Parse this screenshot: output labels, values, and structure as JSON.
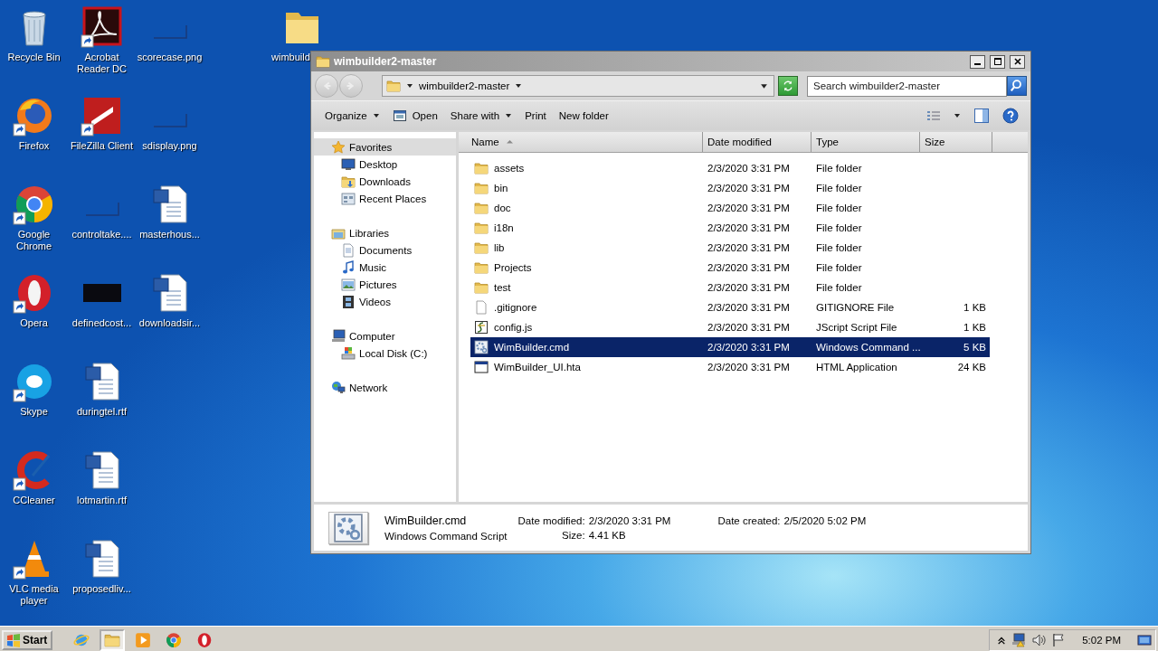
{
  "desktop": {
    "columns": [
      {
        "icons": [
          {
            "label": "Recycle Bin",
            "kind": "recycle",
            "shortcut": false
          },
          {
            "label": "Firefox",
            "kind": "firefox",
            "shortcut": true
          },
          {
            "label": "Google Chrome",
            "kind": "chrome",
            "shortcut": true
          },
          {
            "label": "Opera",
            "kind": "opera",
            "shortcut": true
          },
          {
            "label": "Skype",
            "kind": "skype",
            "shortcut": true
          },
          {
            "label": "CCleaner",
            "kind": "ccleaner",
            "shortcut": true
          },
          {
            "label": "VLC media player",
            "kind": "vlc",
            "shortcut": true
          }
        ]
      },
      {
        "icons": [
          {
            "label": "Acrobat Reader DC",
            "kind": "acrobat",
            "shortcut": true
          },
          {
            "label": "FileZilla Client",
            "kind": "filezilla",
            "shortcut": true
          },
          {
            "label": "controltake....",
            "kind": "image",
            "shortcut": false
          },
          {
            "label": "definedcost...",
            "kind": "dark",
            "shortcut": false
          },
          {
            "label": "duringtel.rtf",
            "kind": "word",
            "shortcut": false
          },
          {
            "label": "lotmartin.rtf",
            "kind": "word",
            "shortcut": false
          },
          {
            "label": "proposedliv...",
            "kind": "word",
            "shortcut": false
          }
        ]
      },
      {
        "icons": [
          {
            "label": "scorecase.png",
            "kind": "image",
            "shortcut": false
          },
          {
            "label": "sdisplay.png",
            "kind": "image",
            "shortcut": false
          },
          {
            "label": "masterhous...",
            "kind": "word",
            "shortcut": false
          },
          {
            "label": "downloadsir...",
            "kind": "word",
            "shortcut": false
          }
        ]
      }
    ],
    "partial_icon": {
      "label": "wimbuild",
      "kind": "folder"
    }
  },
  "window": {
    "title": "wimbuilder2-master",
    "navigation": {
      "back": {
        "disabled": true
      },
      "forward": {
        "disabled": true
      }
    },
    "address": {
      "segments": [
        "wimbuilder2-master"
      ]
    },
    "search": {
      "placeholder": "Search wimbuilder2-master"
    },
    "toolbar": [
      {
        "label": "Organize",
        "kind": "menu"
      },
      {
        "label": "Open",
        "kind": "open"
      },
      {
        "label": "Share with",
        "kind": "menu"
      },
      {
        "label": "Print",
        "kind": "plain"
      },
      {
        "label": "New folder",
        "kind": "plain"
      }
    ],
    "navigation_pane": [
      {
        "label": "Favorites",
        "selected": true,
        "children": [
          {
            "label": "Desktop",
            "selected": false
          },
          {
            "label": "Downloads",
            "selected": false
          },
          {
            "label": "Recent Places",
            "selected": false
          }
        ]
      },
      {
        "label": "Libraries",
        "selected": false,
        "children": [
          {
            "label": "Documents",
            "selected": false
          },
          {
            "label": "Music",
            "selected": false
          },
          {
            "label": "Pictures",
            "selected": false
          },
          {
            "label": "Videos",
            "selected": false
          }
        ]
      },
      {
        "label": "Computer",
        "selected": false,
        "children": [
          {
            "label": "Local Disk (C:)",
            "selected": false
          }
        ]
      },
      {
        "label": "Network",
        "selected": false
      }
    ],
    "table": {
      "columns": [
        {
          "label": "Name",
          "sorted": true
        },
        {
          "label": "Date modified",
          "sorted": false
        },
        {
          "label": "Type",
          "sorted": false
        },
        {
          "label": "Size",
          "sorted": false
        }
      ],
      "rows": [
        {
          "name": "assets",
          "date": "2/3/2020 3:31 PM",
          "type": "File folder",
          "kind": "folder",
          "selected": false
        },
        {
          "name": "bin",
          "date": "2/3/2020 3:31 PM",
          "type": "File folder",
          "kind": "folder",
          "selected": false
        },
        {
          "name": "doc",
          "date": "2/3/2020 3:31 PM",
          "type": "File folder",
          "kind": "folder",
          "selected": false
        },
        {
          "name": "i18n",
          "date": "2/3/2020 3:31 PM",
          "type": "File folder",
          "kind": "folder",
          "selected": false
        },
        {
          "name": "lib",
          "date": "2/3/2020 3:31 PM",
          "type": "File folder",
          "kind": "folder",
          "selected": false
        },
        {
          "name": "Projects",
          "date": "2/3/2020 3:31 PM",
          "type": "File folder",
          "kind": "folder",
          "selected": false
        },
        {
          "name": "test",
          "date": "2/3/2020 3:31 PM",
          "type": "File folder",
          "kind": "folder",
          "selected": false
        },
        {
          "name": ".gitignore",
          "date": "2/3/2020 3:31 PM",
          "type": "GITIGNORE File",
          "size": "1 KB",
          "kind": "blank",
          "selected": false
        },
        {
          "name": "config.js",
          "date": "2/3/2020 3:31 PM",
          "type": "JScript Script File",
          "size": "1 KB",
          "kind": "jscript",
          "selected": false
        },
        {
          "name": "WimBuilder.cmd",
          "date": "2/3/2020 3:31 PM",
          "type": "Windows Command ...",
          "size": "5 KB",
          "kind": "cmd",
          "selected": true
        },
        {
          "name": "WimBuilder_UI.hta",
          "date": "2/3/2020 3:31 PM",
          "type": "HTML Application",
          "size": "24 KB",
          "kind": "hta",
          "selected": false
        }
      ]
    },
    "details": {
      "name": "WimBuilder.cmd",
      "type": "Windows Command Script",
      "properties": [
        {
          "label": "Date modified:",
          "value": "2/3/2020 3:31 PM"
        },
        {
          "label": "Size:",
          "value": "4.41 KB"
        },
        {
          "label": "Date created:",
          "value": "2/5/2020 5:02 PM"
        }
      ]
    }
  },
  "taskbar": {
    "start": "Start",
    "apps": [
      {
        "kind": "ie",
        "selected": false
      },
      {
        "kind": "explorer",
        "selected": true
      },
      {
        "kind": "media",
        "selected": false
      },
      {
        "kind": "chrome",
        "selected": false
      },
      {
        "kind": "opera",
        "selected": false
      }
    ],
    "clock": "5:02 PM"
  }
}
